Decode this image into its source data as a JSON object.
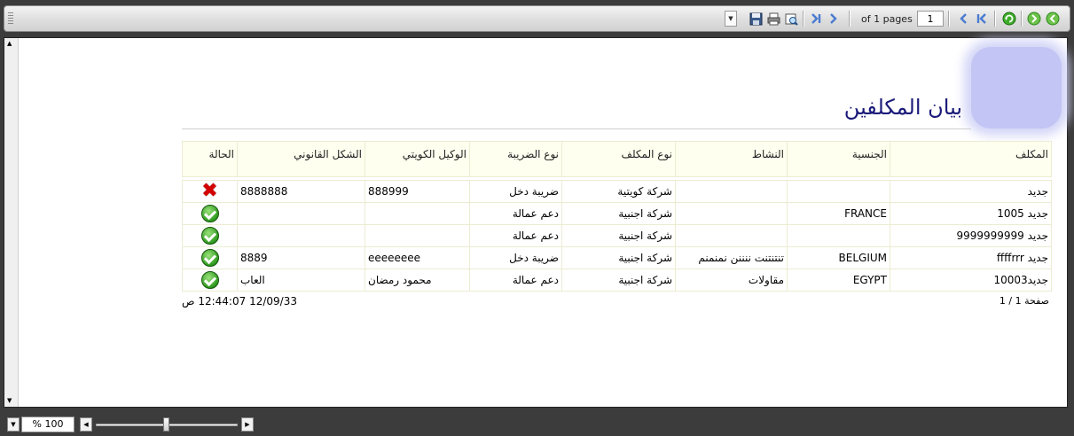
{
  "toolbar": {
    "pages_label": "of 1 pages",
    "current_page": "1"
  },
  "report": {
    "title": "بيان المكلفين",
    "columns": [
      "المكلف",
      "الجنسية",
      "النشاط",
      "نوع المكلف",
      "نوع الضريبة",
      "الوكيل الكويتي",
      "الشكل القانوني",
      "الحالة"
    ],
    "rows": [
      {
        "name": "جديد",
        "nationality": "",
        "activity": "",
        "type": "شركة كويتية",
        "tax": "ضريبة دخل",
        "agent": "888999",
        "legal": "8888888",
        "status": "rejected"
      },
      {
        "name": "جديد 1005",
        "nationality": "FRANCE",
        "activity": "",
        "type": "شركة اجنبية",
        "tax": "دعم عمالة",
        "agent": "",
        "legal": "",
        "status": "approved"
      },
      {
        "name": "جديد 9999999999",
        "nationality": "",
        "activity": "",
        "type": "شركة اجنبية",
        "tax": "دعم عمالة",
        "agent": "",
        "legal": "",
        "status": "approved"
      },
      {
        "name": "جديد ffffrrr",
        "nationality": "BELGIUM",
        "activity": "تنتنتنت ننننن نمنمنم",
        "type": "شركة اجنبية",
        "tax": "ضريبة دخل",
        "agent": "eeeeeeee",
        "legal": "8889",
        "status": "approved"
      },
      {
        "name": "جديد10003",
        "nationality": "EGYPT",
        "activity": "مقاولات",
        "type": "شركة اجنبية",
        "tax": "دعم عمالة",
        "agent": "محمود رمضان",
        "legal": "العاب",
        "status": "approved"
      }
    ],
    "footer_page": "صفحة 1 / 1",
    "footer_date": "12/09/33 12:44:07 ص"
  },
  "zoom": {
    "value": "100 %",
    "level_fraction": 0.5
  },
  "colors": {
    "title": "#1a1a7a",
    "header_bg": "#ffffef",
    "approved": "#2e9a1e",
    "rejected": "#d40000"
  }
}
